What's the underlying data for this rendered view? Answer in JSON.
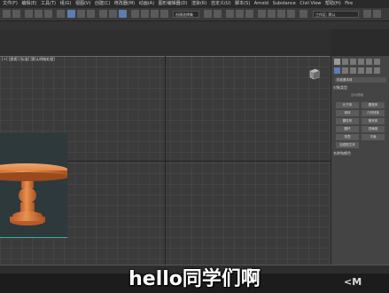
{
  "menubar": {
    "items": [
      "文件(F)",
      "编辑(E)",
      "工具(T)",
      "组(G)",
      "视图(V)",
      "创建(C)",
      "修改器(M)",
      "动画(A)",
      "图形编辑器(D)",
      "渲染(R)",
      "自定义(U)",
      "脚本(S)",
      "Arnold",
      "Substance",
      "Civil View",
      "帮助(H)",
      "Fire"
    ]
  },
  "toolbar": {
    "selection_filter": "全部",
    "named_selection": "创建选择集",
    "workspace_dropdown": "工作区: 默认"
  },
  "viewport": {
    "label": "[+] [透视] [标准] [默认明暗处理]"
  },
  "command_panel": {
    "section_object_type": "对象类型",
    "auto_grid": "自动栅格",
    "buttons": [
      "长方体",
      "圆锥体",
      "球体",
      "几何球体",
      "圆柱体",
      "管状体",
      "圆环",
      "四棱锥",
      "茶壶",
      "平面",
      "加强型文本"
    ],
    "section_name_color": "名称和颜色",
    "category": "标准基本体"
  },
  "subtitle": "hello同学们啊",
  "watermark": "<M"
}
